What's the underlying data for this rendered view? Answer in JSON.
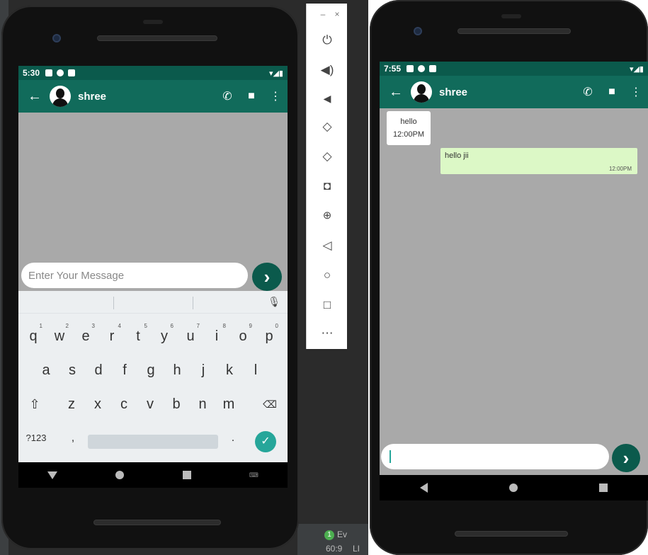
{
  "left_phone": {
    "status": {
      "time": "5:30"
    },
    "toolbar": {
      "contact_name": "shree"
    },
    "input": {
      "placeholder": "Enter Your Message"
    },
    "keyboard": {
      "row1": [
        {
          "k": "q",
          "n": "1"
        },
        {
          "k": "w",
          "n": "2"
        },
        {
          "k": "e",
          "n": "3"
        },
        {
          "k": "r",
          "n": "4"
        },
        {
          "k": "t",
          "n": "5"
        },
        {
          "k": "y",
          "n": "6"
        },
        {
          "k": "u",
          "n": "7"
        },
        {
          "k": "i",
          "n": "8"
        },
        {
          "k": "o",
          "n": "9"
        },
        {
          "k": "p",
          "n": "0"
        }
      ],
      "row2": [
        "a",
        "s",
        "d",
        "f",
        "g",
        "h",
        "j",
        "k",
        "l"
      ],
      "row3": [
        "z",
        "x",
        "c",
        "v",
        "b",
        "n",
        "m"
      ],
      "symbols_key": "?123",
      "comma_key": ",",
      "period_key": "."
    }
  },
  "right_phone": {
    "status": {
      "time": "7:55"
    },
    "toolbar": {
      "contact_name": "shree"
    },
    "messages": [
      {
        "direction": "incoming",
        "text": "hello",
        "time": "12:00PM"
      },
      {
        "direction": "outgoing",
        "text": "hello jii",
        "time": "12:00PM"
      }
    ],
    "input": {
      "value": ""
    }
  },
  "emulator_toolbar": {
    "window_controls": [
      "minimize",
      "close"
    ],
    "tools": [
      "power-icon",
      "volume-up-icon",
      "volume-down-icon",
      "rotate-left-icon",
      "rotate-right-icon",
      "camera-icon",
      "zoom-icon",
      "back-icon",
      "home-icon",
      "overview-icon",
      "more-icon"
    ]
  },
  "ide_status": {
    "badge": "1",
    "event_label": "Ev",
    "position": "60:9",
    "line_label": "LI"
  }
}
